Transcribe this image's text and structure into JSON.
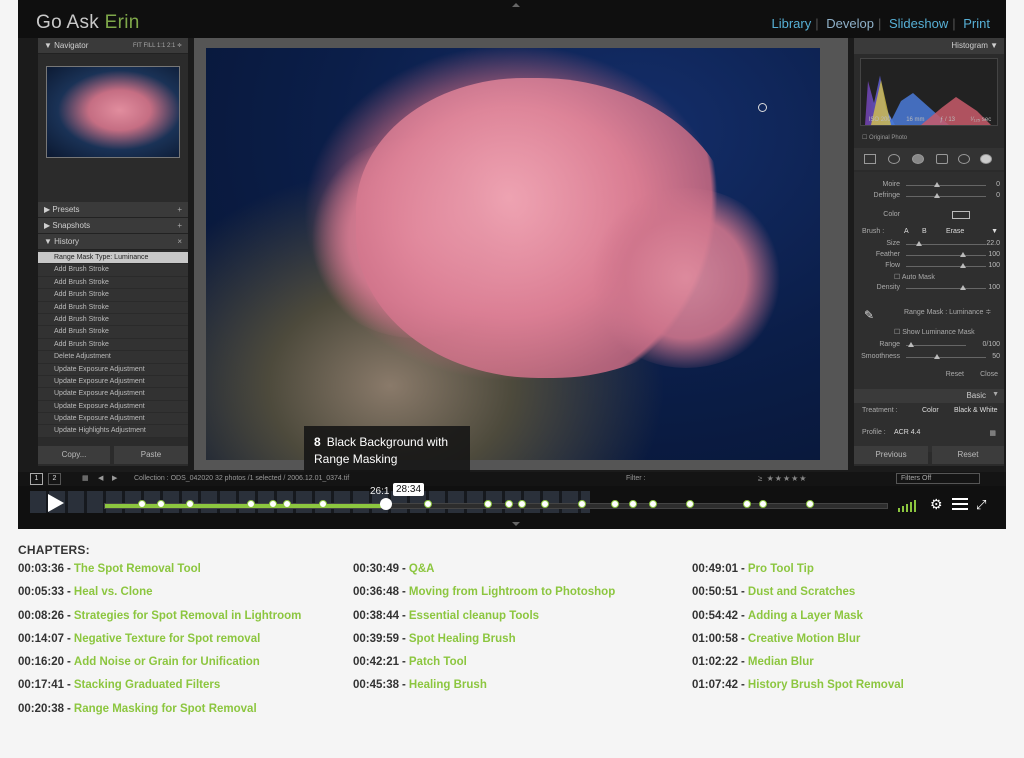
{
  "video": {
    "brand": {
      "part1": "Go Ask ",
      "part2": "Erin"
    },
    "modules": [
      "Library",
      "Develop",
      "Slideshow",
      "Print"
    ],
    "left_panel": {
      "navigator_title": "Navigator",
      "navigator_tools": "FIT  FILL  1:1  2:1 ≑",
      "presets_title": "Presets",
      "snapshots_title": "Snapshots",
      "history_title": "History",
      "history_items": [
        "Range Mask Type: Luminance",
        "Add Brush Stroke",
        "Add Brush Stroke",
        "Add Brush Stroke",
        "Add Brush Stroke",
        "Add Brush Stroke",
        "Add Brush Stroke",
        "Add Brush Stroke",
        "Delete Adjustment",
        "Update Exposure Adjustment",
        "Update Exposure Adjustment",
        "Update Exposure Adjustment",
        "Update Exposure Adjustment",
        "Update Exposure Adjustment",
        "Update Highlights Adjustment"
      ],
      "copy_label": "Copy...",
      "paste_label": "Paste"
    },
    "right_panel": {
      "histogram_title": "Histogram",
      "exif": [
        "ISO 200",
        "16 mm",
        "ƒ / 13",
        "¹⁄₁₂₅ sec"
      ],
      "original_photo": "Original Photo",
      "rows": [
        {
          "label": "Moire",
          "value": "0"
        },
        {
          "label": "Defringe",
          "value": "0"
        },
        {
          "label": "Color",
          "value": ""
        }
      ],
      "brush_label": "Brush :",
      "brush_a": "A",
      "brush_b": "B",
      "brush_erase": "Erase",
      "brush_rows": [
        {
          "label": "Size",
          "value": "22.0"
        },
        {
          "label": "Feather",
          "value": "100"
        },
        {
          "label": "Flow",
          "value": "100"
        }
      ],
      "auto_mask": "Auto Mask",
      "density": {
        "label": "Density",
        "value": "100"
      },
      "range_mask": "Range Mask : Luminance ≑",
      "show_lum": "Show Luminance Mask",
      "range": {
        "label": "Range",
        "value": "0/100"
      },
      "smoothness": {
        "label": "Smoothness",
        "value": "50"
      },
      "reset": "Reset",
      "close": "Close",
      "basic_title": "Basic",
      "treatment_label": "Treatment :",
      "treatment_color": "Color",
      "treatment_bw": "Black & White",
      "profile_label": "Profile :",
      "profile_value": "ACR 4.4",
      "previous_label": "Previous",
      "reset_label": "Reset"
    },
    "filmstrip": {
      "page1": "1",
      "page2": "2",
      "collection": "Collection : ODS_042020      32 photos /1 selected / 2006.12.01_0374.tif",
      "filter": "Filter :",
      "stars": "≥ ★★★★★",
      "filters_off": "Filters Off"
    },
    "player": {
      "chapter_tip_number": "8",
      "chapter_tip_title": "Black Background with Range Masking",
      "time_current": "26:1",
      "time_hover": "28:34",
      "progress": 0.36
    }
  },
  "chapters": {
    "title": "CHAPTERS:",
    "columns": [
      [
        {
          "time": "00:03:36",
          "label": "The Spot Removal Tool"
        },
        {
          "time": "00:05:33",
          "label": "Heal vs. Clone"
        },
        {
          "time": "00:08:26",
          "label": "Strategies for Spot Removal in Lightroom"
        },
        {
          "time": "00:14:07",
          "label": "Negative Texture for Spot removal"
        },
        {
          "time": "00:16:20",
          "label": "Add Noise or Grain for Unification"
        },
        {
          "time": "00:17:41",
          "label": "Stacking Graduated Filters"
        },
        {
          "time": "00:20:38",
          "label": "Range Masking for Spot Removal"
        }
      ],
      [
        {
          "time": "00:30:49",
          "label": "Q&A"
        },
        {
          "time": "00:36:48",
          "label": "Moving from Lightroom to Photoshop"
        },
        {
          "time": "00:38:44",
          "label": "Essential cleanup Tools"
        },
        {
          "time": "00:39:59",
          "label": "Spot Healing Brush"
        },
        {
          "time": "00:42:21",
          "label": "Patch Tool"
        },
        {
          "time": "00:45:38",
          "label": "Healing Brush"
        }
      ],
      [
        {
          "time": "00:49:01",
          "label": "Pro Tool Tip"
        },
        {
          "time": "00:50:51",
          "label": "Dust and Scratches"
        },
        {
          "time": "00:54:42",
          "label": "Adding a Layer Mask"
        },
        {
          "time": "01:00:58",
          "label": "Creative Motion Blur"
        },
        {
          "time": "01:02:22",
          "label": "Median Blur"
        },
        {
          "time": "01:07:42",
          "label": "History Brush Spot Removal"
        }
      ]
    ]
  }
}
